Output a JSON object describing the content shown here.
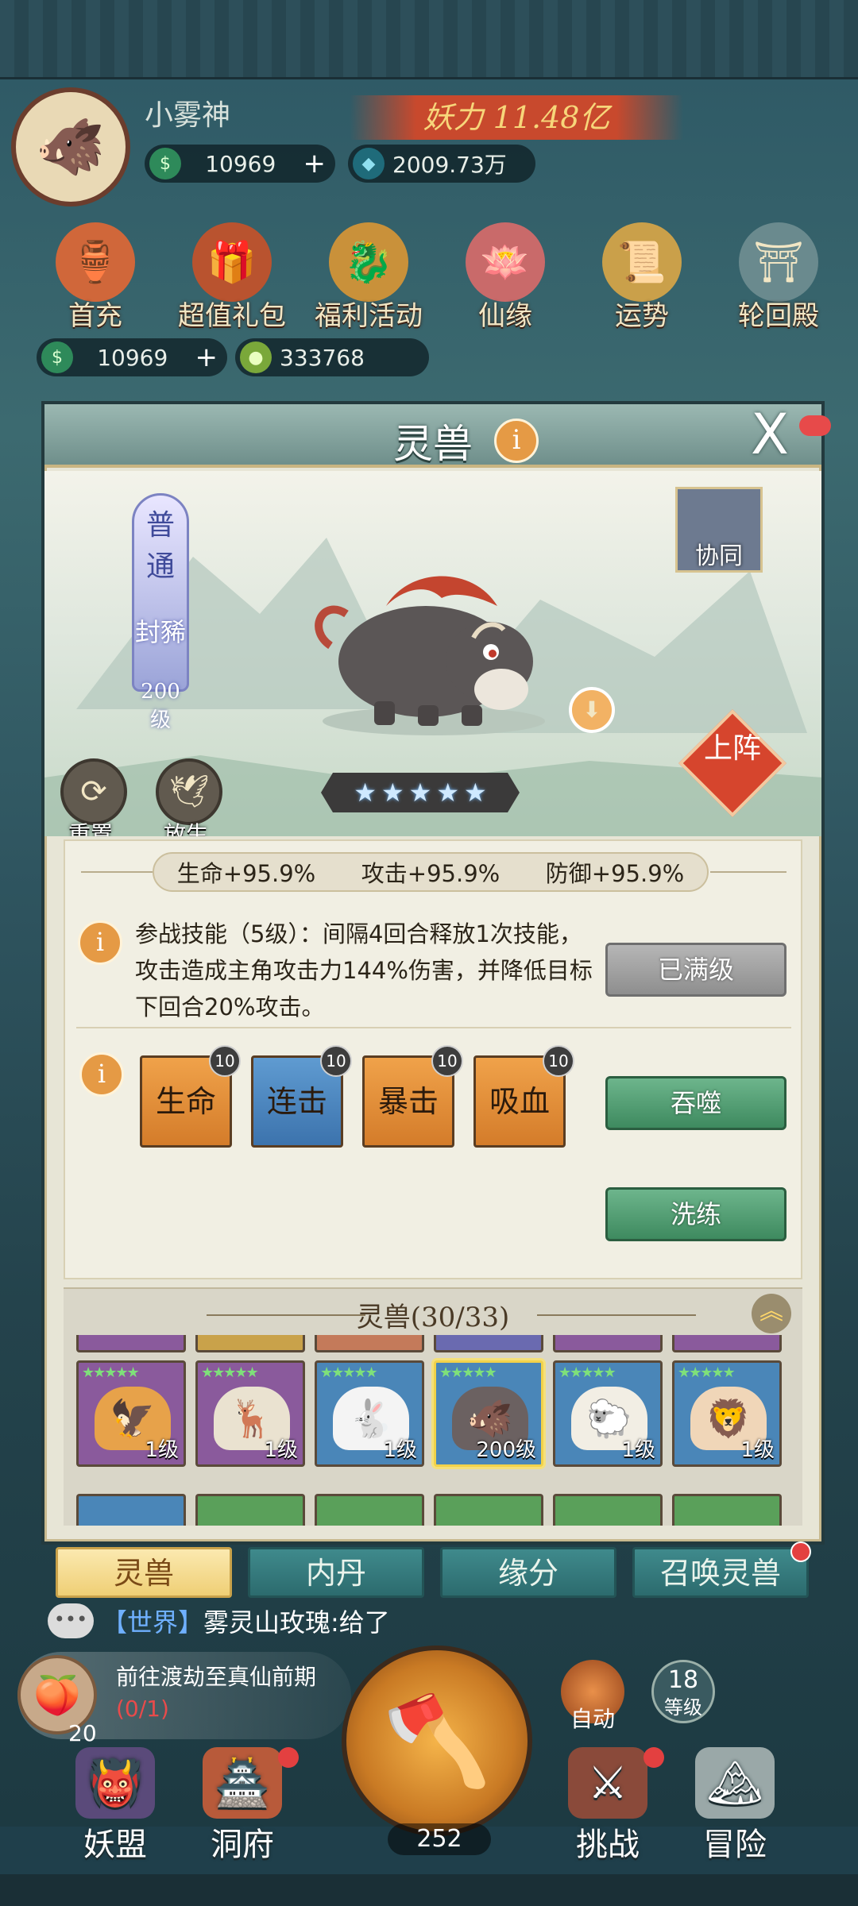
{
  "header": {
    "player_name": "小雾神",
    "power": "妖力 11.48亿",
    "currency_jade": "10969",
    "currency_crystal": "2009.73万"
  },
  "activities": [
    {
      "label": "首充",
      "icon": "gourd-icon"
    },
    {
      "label": "超值礼包",
      "icon": "gift-bag-icon"
    },
    {
      "label": "福利活动",
      "icon": "dragon-icon"
    },
    {
      "label": "仙缘",
      "icon": "lotus-icon"
    },
    {
      "label": "运势",
      "icon": "scroll-icon"
    },
    {
      "label": "轮回殿",
      "icon": "temple-icon"
    }
  ],
  "resources": {
    "jade": "10969",
    "coin": "333768"
  },
  "modal": {
    "title": "灵兽",
    "title_info": "i",
    "close": "X",
    "rarity": {
      "grade": "普通",
      "name": "封豨",
      "level": "200级"
    },
    "cooperate_label": "协同",
    "reset_label": "重置",
    "release_label": "放生",
    "deploy_label": "上阵",
    "stars": 5,
    "attributes": [
      "生命+95.9%",
      "攻击+95.9%",
      "防御+95.9%"
    ],
    "skill_info": "i",
    "skill_text": "参战技能（5级）：间隔4回合释放1次技能，攻击造成主角攻击力144%伤害，并降低目标下回合20%攻击。",
    "max_level_btn": "已满级",
    "devour_btn": "吞噬",
    "refine_btn": "洗练",
    "sub_info": "i",
    "sub_attributes": [
      {
        "label": "生命",
        "level": "10",
        "color": "orange"
      },
      {
        "label": "连击",
        "level": "10",
        "color": "blue"
      },
      {
        "label": "暴击",
        "level": "10",
        "color": "orange"
      },
      {
        "label": "吸血",
        "level": "10",
        "color": "orange"
      }
    ],
    "roster_title": "灵兽(30/33)",
    "roster": [
      {
        "level": "1级",
        "icon": "phoenix-icon",
        "bg": "#8a5a9c",
        "stars": "★★★★★",
        "selected": false
      },
      {
        "level": "1级",
        "icon": "deer-icon",
        "bg": "#8a5a9c",
        "stars": "★★★★★",
        "selected": false
      },
      {
        "level": "1级",
        "icon": "rabbit-icon",
        "bg": "#4a86b8",
        "stars": "★★★★★",
        "selected": false
      },
      {
        "level": "200级",
        "icon": "boar-icon",
        "bg": "#4a86b8",
        "stars": "★★★★★",
        "selected": true
      },
      {
        "level": "1级",
        "icon": "sheep-icon",
        "bg": "#4a86b8",
        "stars": "★★★★★",
        "selected": false
      },
      {
        "level": "1级",
        "icon": "lion-icon",
        "bg": "#4a86b8",
        "stars": "★★★★★",
        "selected": false
      }
    ]
  },
  "tabs": [
    {
      "label": "灵兽",
      "active": true
    },
    {
      "label": "内丹",
      "active": false
    },
    {
      "label": "缘分",
      "active": false
    },
    {
      "label": "召唤灵兽",
      "active": false,
      "dot": true
    }
  ],
  "chat": {
    "bubble": "•••",
    "channel": "【世界】",
    "message": "雾灵山玫瑰:给了"
  },
  "quest": {
    "text": "前往渡劫至真仙前期",
    "count": "(0/1)",
    "number": "20"
  },
  "axe_count": "252",
  "auto_label": "自动",
  "level_box": {
    "value": "18",
    "label": "等级"
  },
  "bottom_nav": [
    {
      "label": "妖盟",
      "icon": "demon-alliance-icon",
      "dot": false
    },
    {
      "label": "洞府",
      "icon": "cave-icon",
      "dot": true
    },
    {
      "label": "挑战",
      "icon": "challenge-icon",
      "dot": true
    },
    {
      "label": "冒险",
      "icon": "adventure-icon",
      "dot": false
    }
  ]
}
